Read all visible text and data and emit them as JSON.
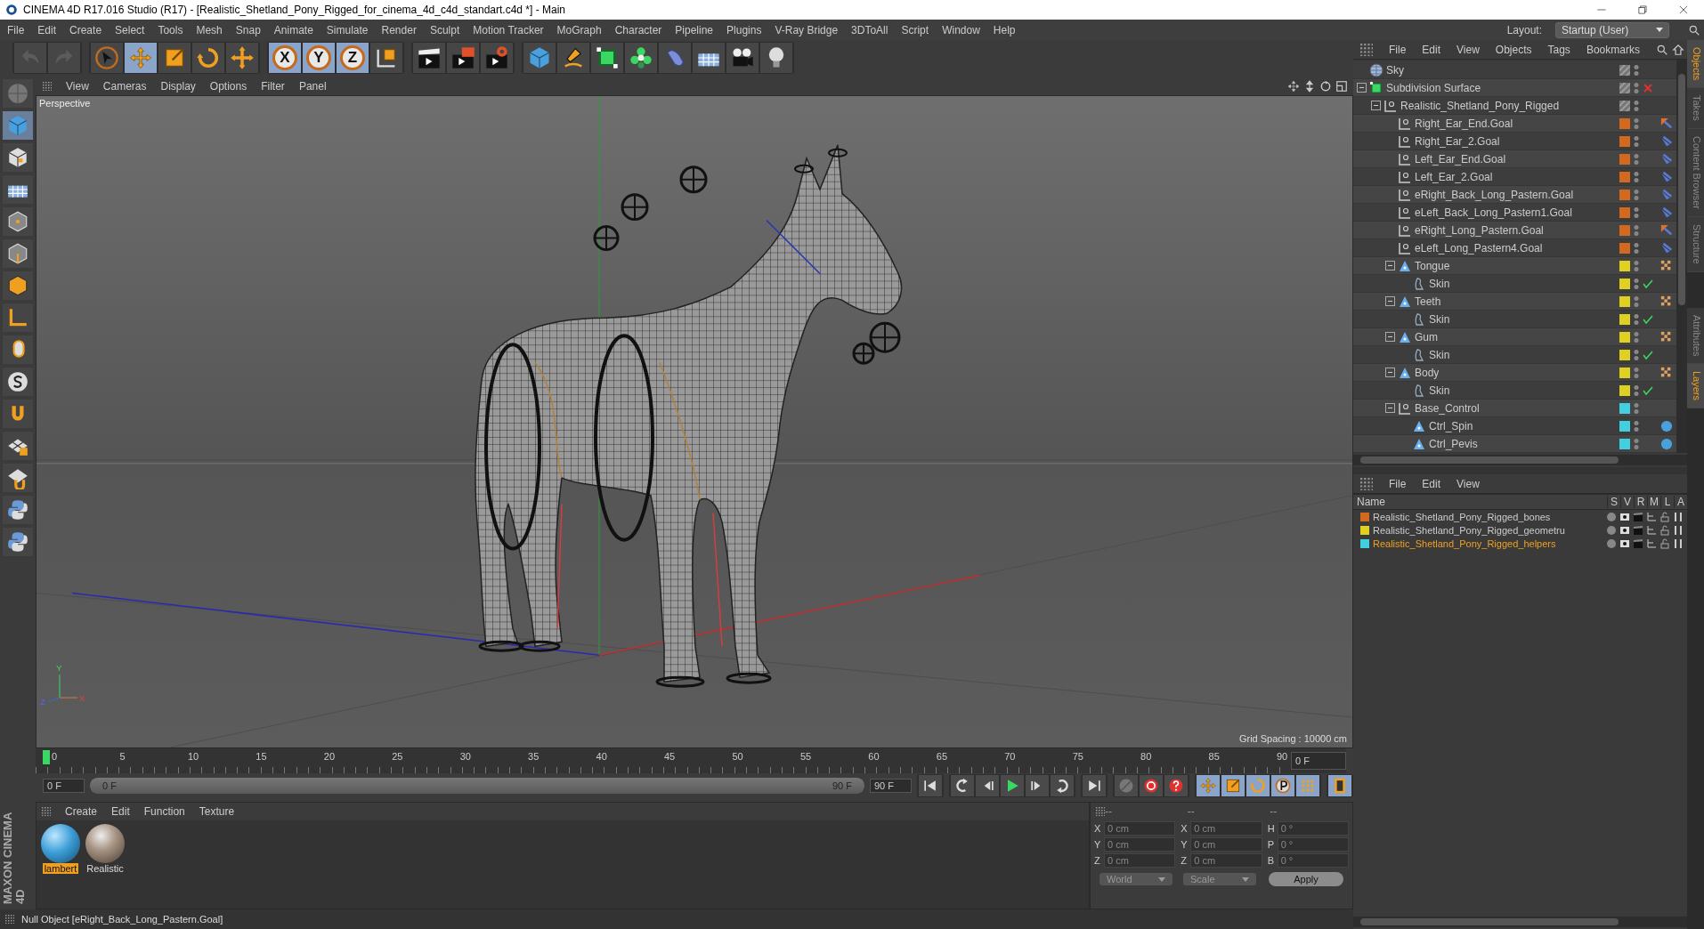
{
  "window": {
    "title": "CINEMA 4D R17.016 Studio (R17) - [Realistic_Shetland_Pony_Rigged_for_cinema_4d_c4d_standart.c4d *] - Main"
  },
  "menu": [
    "File",
    "Edit",
    "Create",
    "Select",
    "Tools",
    "Mesh",
    "Snap",
    "Animate",
    "Simulate",
    "Render",
    "Sculpt",
    "Motion Tracker",
    "MoGraph",
    "Character",
    "Pipeline",
    "Plugins",
    "V-Ray Bridge",
    "3DToAll",
    "Script",
    "Window",
    "Help"
  ],
  "layout": {
    "label": "Layout:",
    "value": "Startup (User)"
  },
  "toolbar": [
    [
      {
        "kind": "undo",
        "selected": false
      },
      {
        "kind": "redo",
        "selected": false
      }
    ],
    [
      {
        "kind": "cursor",
        "selected": false
      },
      {
        "kind": "move",
        "selected": true
      },
      {
        "kind": "scale",
        "selected": false
      },
      {
        "kind": "rotate",
        "selected": false
      },
      {
        "kind": "transform",
        "selected": false
      }
    ],
    [
      {
        "kind": "axis",
        "label": "X",
        "selected": true
      },
      {
        "kind": "axis",
        "label": "Y",
        "selected": true
      },
      {
        "kind": "axis",
        "label": "Z",
        "selected": true
      },
      {
        "kind": "coord",
        "selected": false
      }
    ],
    [
      {
        "kind": "clapper",
        "selected": false
      },
      {
        "kind": "clapper-play",
        "selected": false
      },
      {
        "kind": "clapper-gear",
        "selected": false
      }
    ],
    [
      {
        "kind": "cube",
        "selected": false
      },
      {
        "kind": "pen",
        "selected": false
      },
      {
        "kind": "green-cube",
        "selected": false
      },
      {
        "kind": "flower",
        "selected": false
      },
      {
        "kind": "capsule",
        "selected": false
      },
      {
        "kind": "plane",
        "selected": false
      },
      {
        "kind": "camera",
        "selected": false
      },
      {
        "kind": "bulb",
        "selected": false
      }
    ]
  ],
  "left_toolbar": [
    {
      "kind": "sphere-grey",
      "selected": false
    },
    {
      "kind": "cube",
      "selected": true
    },
    {
      "kind": "checker",
      "selected": false
    },
    {
      "kind": "plane",
      "selected": false
    },
    {
      "kind": "cube-edit",
      "selected": false
    },
    {
      "kind": "cube-edge",
      "selected": false
    },
    {
      "kind": "cube-orange",
      "selected": false
    },
    {
      "kind": "corner",
      "selected": false
    },
    {
      "kind": "hand",
      "selected": false
    },
    {
      "kind": "s-circle",
      "selected": false
    },
    {
      "kind": "magnet",
      "selected": false
    },
    {
      "kind": "grid-lock",
      "selected": false
    },
    {
      "kind": "grid-magnet",
      "selected": false
    },
    {
      "kind": "python",
      "selected": false
    },
    {
      "kind": "python",
      "selected": false
    }
  ],
  "viewport": {
    "menu": [
      "View",
      "Cameras",
      "Display",
      "Options",
      "Filter",
      "Panel"
    ],
    "camera": "Perspective",
    "grid_spacing": "Grid Spacing : 10000 cm",
    "gizmo": [
      "Y",
      "Z",
      "X"
    ]
  },
  "timeline": {
    "ticks": [
      "0",
      "5",
      "10",
      "15",
      "20",
      "25",
      "30",
      "35",
      "40",
      "45",
      "50",
      "55",
      "60",
      "65",
      "70",
      "75",
      "80",
      "85",
      "90"
    ],
    "level": 0,
    "end_field": "0 F",
    "start": "0 F",
    "range": {
      "start": "0 F",
      "end": "90 F",
      "level": 1
    },
    "end": "90 F"
  },
  "transport": [
    [
      {
        "kind": "first",
        "selected": false
      }
    ],
    [
      {
        "kind": "prev-key",
        "selected": false
      },
      {
        "kind": "prev",
        "selected": false
      },
      {
        "kind": "play",
        "selected": false
      },
      {
        "kind": "next",
        "selected": false
      },
      {
        "kind": "next-key",
        "selected": false
      }
    ],
    [
      {
        "kind": "last",
        "selected": false
      }
    ],
    [
      {
        "kind": "record-off",
        "selected": false
      },
      {
        "kind": "record",
        "selected": false
      },
      {
        "kind": "help",
        "selected": false
      }
    ],
    [
      {
        "kind": "move",
        "selected": true
      },
      {
        "kind": "scale",
        "selected": true
      },
      {
        "kind": "rotate",
        "selected": true
      },
      {
        "kind": "p",
        "selected": true
      },
      {
        "kind": "dots",
        "selected": true
      }
    ],
    [
      {
        "kind": "film",
        "selected": true
      }
    ]
  ],
  "materials": {
    "menu": [
      "Create",
      "Edit",
      "Function",
      "Texture"
    ],
    "items": [
      {
        "name": "lambert",
        "kind": "blue",
        "selected": true
      },
      {
        "name": "Realistic",
        "kind": "textured",
        "selected": false
      }
    ]
  },
  "brand": "MAXON CINEMA 4D",
  "coordinates": {
    "headers": [
      "--",
      "--",
      "--"
    ],
    "rows": [
      [
        {
          "label": "X",
          "value": "0 cm"
        },
        {
          "label": "X",
          "value": "0 cm"
        },
        {
          "label": "H",
          "value": "0 °"
        }
      ],
      [
        {
          "label": "Y",
          "value": "0 cm"
        },
        {
          "label": "Y",
          "value": "0 cm"
        },
        {
          "label": "P",
          "value": "0 °"
        }
      ],
      [
        {
          "label": "Z",
          "value": "0 cm"
        },
        {
          "label": "Z",
          "value": "0 cm"
        },
        {
          "label": "B",
          "value": "0 °"
        }
      ]
    ],
    "space": "World",
    "mode": "Scale",
    "apply": "Apply"
  },
  "status_bar": "Null Object [eRight_Back_Long_Pastern.Goal]",
  "objects": {
    "menu": [
      "File",
      "Edit",
      "View",
      "Objects",
      "Tags",
      "Bookmarks"
    ],
    "tree": [
      {
        "name": "Sky",
        "kind": "sky"
      },
      {
        "name": "Subdivision Surface",
        "kind": "subdivision",
        "expanded": true,
        "enabled": false,
        "children": [
          {
            "name": "Realistic_Shetland_Pony_Rigged",
            "kind": "null",
            "expanded": true,
            "children": [
              {
                "name": "Right_Ear_End.Goal",
                "kind": "null",
                "color": "#d2691e",
                "tags": [
                  {
                    "kind": "ik-goal"
                  }
                ]
              },
              {
                "name": "Right_Ear_2.Goal",
                "kind": "null",
                "color": "#d2691e",
                "tags": [
                  {
                    "kind": "ik"
                  }
                ]
              },
              {
                "name": "Left_Ear_End.Goal",
                "kind": "null",
                "color": "#d2691e",
                "tags": [
                  {
                    "kind": "ik"
                  }
                ]
              },
              {
                "name": "Left_Ear_2.Goal",
                "kind": "null",
                "color": "#d2691e",
                "tags": [
                  {
                    "kind": "ik"
                  }
                ]
              },
              {
                "name": "eRight_Back_Long_Pastern.Goal",
                "kind": "null",
                "color": "#d2691e",
                "tags": [
                  {
                    "kind": "ik"
                  }
                ]
              },
              {
                "name": "eLeft_Back_Long_Pastern1.Goal",
                "kind": "null",
                "color": "#d2691e",
                "tags": [
                  {
                    "kind": "ik"
                  }
                ]
              },
              {
                "name": "eRight_Long_Pastern.Goal",
                "kind": "null",
                "color": "#d2691e",
                "tags": [
                  {
                    "kind": "ik-goal"
                  }
                ]
              },
              {
                "name": "eLeft_Long_Pastern4.Goal",
                "kind": "null",
                "color": "#d2691e",
                "tags": [
                  {
                    "kind": "ik"
                  }
                ]
              },
              {
                "name": "Tongue",
                "kind": "mesh",
                "color": "#e0d020",
                "expanded": true,
                "tags": [
                  {
                    "kind": "weight"
                  }
                ],
                "children": [
                  {
                    "name": "Skin",
                    "kind": "skin",
                    "color": "#e0d020",
                    "enabled": true
                  }
                ]
              },
              {
                "name": "Teeth",
                "kind": "mesh",
                "color": "#e0d020",
                "expanded": true,
                "tags": [
                  {
                    "kind": "weight"
                  }
                ],
                "children": [
                  {
                    "name": "Skin",
                    "kind": "skin",
                    "color": "#e0d020",
                    "enabled": true
                  }
                ]
              },
              {
                "name": "Gum",
                "kind": "mesh",
                "color": "#e0d020",
                "expanded": true,
                "tags": [
                  {
                    "kind": "weight"
                  }
                ],
                "children": [
                  {
                    "name": "Skin",
                    "kind": "skin",
                    "color": "#e0d020",
                    "enabled": true
                  }
                ]
              },
              {
                "name": "Body",
                "kind": "mesh",
                "color": "#e0d020",
                "expanded": true,
                "tags": [
                  {
                    "kind": "weight"
                  }
                ],
                "children": [
                  {
                    "name": "Skin",
                    "kind": "skin",
                    "color": "#e0d020",
                    "enabled": true
                  }
                ]
              },
              {
                "name": "Base_Control",
                "kind": "null",
                "color": "#40d0e0",
                "expanded": true,
                "children": [
                  {
                    "name": "Ctrl_Spin",
                    "kind": "mesh",
                    "color": "#40d0e0",
                    "tags": [
                      {
                        "kind": "sphere"
                      }
                    ]
                  },
                  {
                    "name": "Ctrl_Pevis",
                    "kind": "mesh",
                    "color": "#40d0e0",
                    "tags": [
                      {
                        "kind": "sphere"
                      }
                    ]
                  }
                ]
              }
            ]
          }
        ]
      }
    ]
  },
  "right_tabs_top": [
    {
      "label": "Objects",
      "selected": true
    },
    {
      "label": "Takes",
      "selected": false
    },
    {
      "label": "Content Browser",
      "selected": false
    },
    {
      "label": "Structure",
      "selected": false
    }
  ],
  "layers": {
    "menu": [
      "File",
      "Edit",
      "View"
    ],
    "columns": [
      "Name",
      "S",
      "V",
      "R",
      "M",
      "L",
      "A"
    ],
    "rows": [
      {
        "name": "Realistic_Shetland_Pony_Rigged_bones",
        "color": "#d2691e",
        "selected": false
      },
      {
        "name": "Realistic_Shetland_Pony_Rigged_geometru",
        "color": "#e0d020",
        "selected": false
      },
      {
        "name": "Realistic_Shetland_Pony_Rigged_helpers",
        "color": "#40d0e0",
        "selected": true
      }
    ]
  },
  "right_tabs_bottom": [
    {
      "label": "Attributes",
      "selected": false
    },
    {
      "label": "Layers",
      "selected": true
    }
  ]
}
